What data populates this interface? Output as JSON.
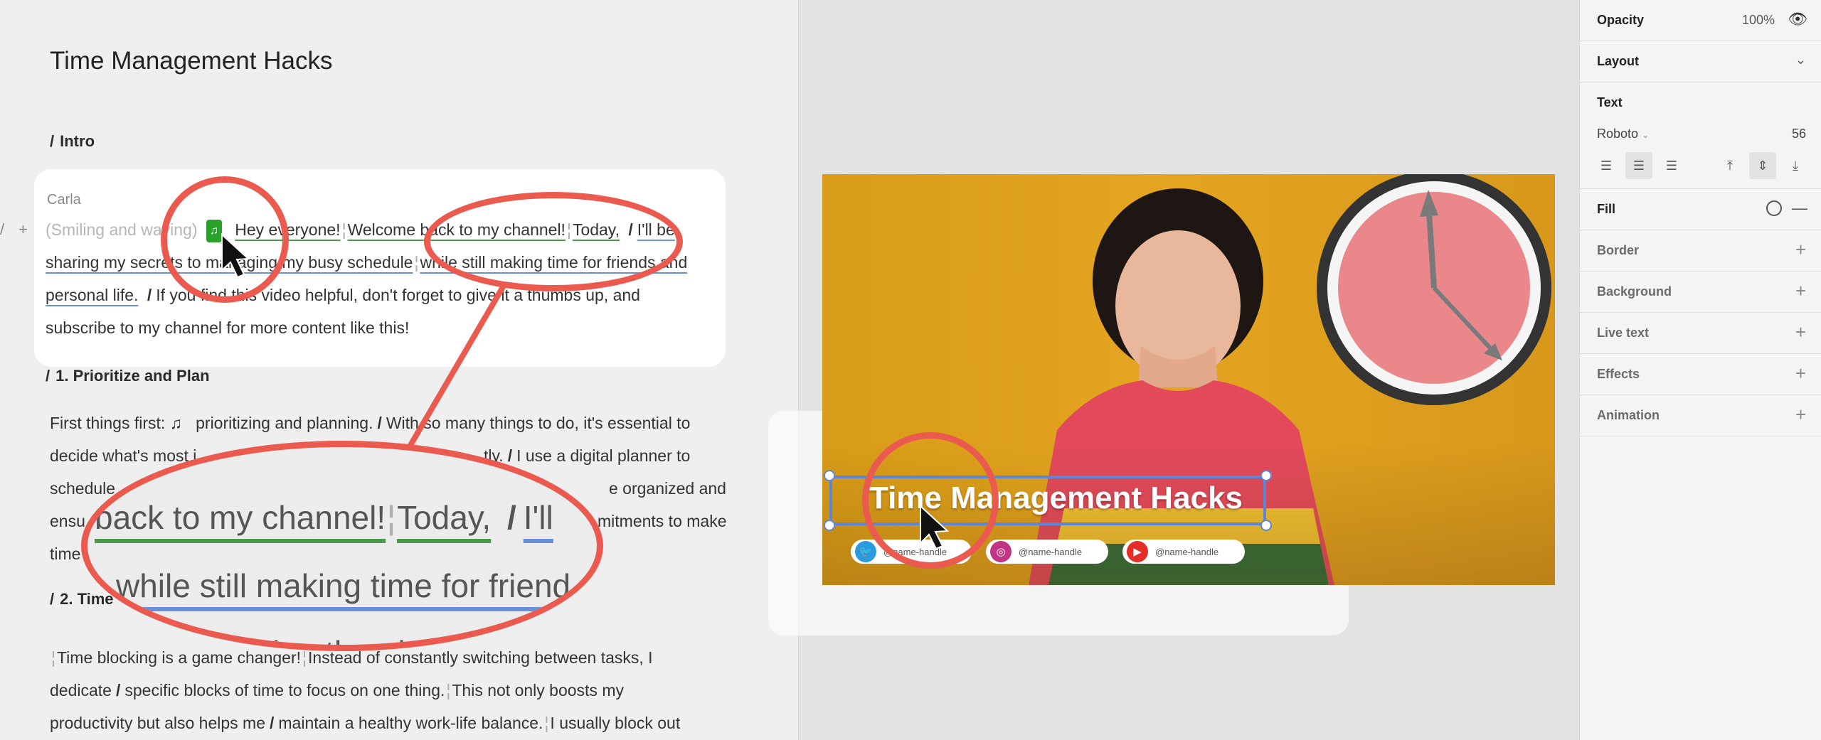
{
  "script": {
    "title": "Time Management Hacks",
    "intro_heading": "Intro",
    "speaker": "Carla",
    "row_tools": {
      "drag": "/",
      "add": "+"
    },
    "intro_line1": {
      "direction": "(Smiling and waving)",
      "music_chip": "♫",
      "seg1": "Hey everyone!",
      "seg2": "Welcome back to my channel!",
      "seg3": "Today,",
      "slash": "/",
      "seg4": "I'll be"
    },
    "intro_line2": {
      "seg1": "sharing my secrets to managing my busy schedule",
      "seg2": "while still making time for friends and"
    },
    "intro_line3": {
      "seg1": "personal life.",
      "slash": "/",
      "seg2": "If you find this video helpful, don't forget to give it a thumbs up, and"
    },
    "intro_line4": "subscribe to my channel for more content like this!",
    "section1_heading": "1. Prioritize and Plan",
    "section1_lines": [
      {
        "pre": "First things first: ♫",
        "post": "prioritizing and planning.",
        "slash": "/",
        "rest": "With so many things to do, it's essential to"
      },
      {
        "text": "decide what's most i"
      },
      {
        "text": "schedule"
      },
      {
        "text": "ensu"
      },
      {
        "text": "time"
      }
    ],
    "section1_tail": {
      "l2": "tly.",
      "slash": "/",
      "l2b": "I use a digital planner to",
      "l3": "e organized and",
      "l4": "mitments to make"
    },
    "section2_heading": "2. Time",
    "section2_lines": [
      "Time blocking is a game changer!",
      "Instead of constantly switching between tasks, I",
      "dedicate",
      "specific blocks of time to focus on one thing.",
      "This not only boosts my",
      "productivity but also helps me",
      "maintain a healthy work-life balance.",
      "I usually block out"
    ],
    "zoom": {
      "line1a": "back to my channel!",
      "line1b": "Today,",
      "line1c": "/",
      "line1d": "I'll",
      "line2": "while still making time for friend",
      "line3": "it a thumb"
    }
  },
  "thumbnail": {
    "title": "Time Management Hacks",
    "socials": [
      {
        "icon": "twitter-icon",
        "glyph": "🐦",
        "handle": "@name-handle",
        "color": "#2a9bdf"
      },
      {
        "icon": "instagram-icon",
        "glyph": "◎",
        "handle": "@name-handle",
        "color": "#c13584"
      },
      {
        "icon": "youtube-icon",
        "glyph": "▶",
        "handle": "@name-handle",
        "color": "#e52d27"
      }
    ]
  },
  "properties": {
    "opacity_label": "Opacity",
    "opacity_value": "100%",
    "layout_label": "Layout",
    "text_label": "Text",
    "font_name": "Roboto",
    "font_size": "56",
    "fill_label": "Fill",
    "border_label": "Border",
    "background_label": "Background",
    "live_text_label": "Live text",
    "effects_label": "Effects",
    "animation_label": "Animation"
  },
  "colors": {
    "accent_red": "#ea5a4e",
    "selection_blue": "#5e86d6",
    "music_green": "#2aa12a"
  }
}
